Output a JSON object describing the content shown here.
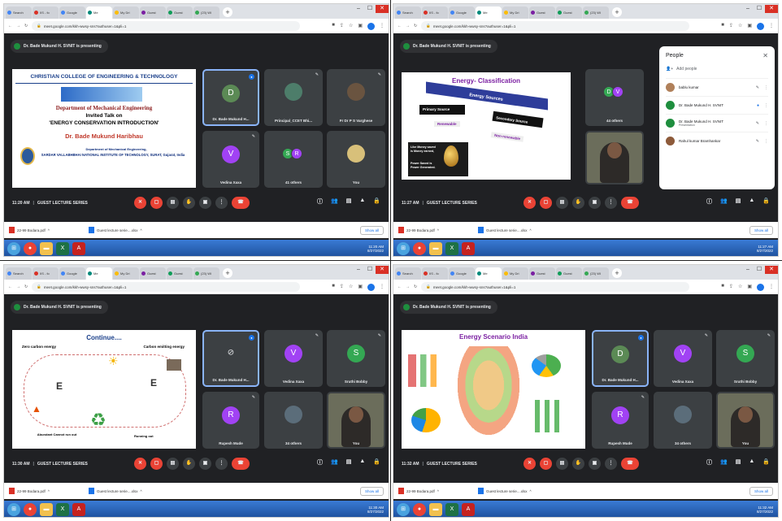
{
  "browser": {
    "tabs": [
      "Search",
      "IIS - fo",
      "Google",
      "Me",
      "My Dri",
      "Guest",
      "Guest",
      "(23) WI"
    ],
    "url": "meet.google.com/kkh-wwsy-sns?authuser=1&pli=1",
    "window_buttons": [
      "–",
      "☐",
      "✕"
    ]
  },
  "presenting_label": "Dr. Bade Mukund H. SVNIT is presenting",
  "meeting_name": "GUEST LECTURE SERIES",
  "downloads": {
    "items": [
      "22-99 Bodara.pdf",
      "Guest lecture serie....xlsx"
    ],
    "show_all": "Show all"
  },
  "panels": [
    {
      "time": "11:20 AM",
      "taskbar_clock": [
        "11:20 AM",
        "8/27/2022"
      ],
      "slide": {
        "college": "CHRISTIAN COLLEGE OF ENGINEERING & TECHNOLOGY",
        "dept": "Department of Mechanical Engineering",
        "talk": "Invited Talk on",
        "topic": "'ENERGY CONSERVATION INTRODUCTION'",
        "speaker": "Dr. Bade Mukund Haribhau",
        "affil_1": "Department of Mechanical Engineering,",
        "affil_2": "SARDAR VALLABHBHAI NATIONAL INSTITUTE OF TECHNOLOGY, SURAT, Gujarat, India"
      },
      "tiles": [
        {
          "name": "Dr. Bade Mukund H...",
          "initial": "D"
        },
        {
          "name": "Principal_CCET Bhi..."
        },
        {
          "name": "Fr Dr P S Varghese"
        },
        {
          "name": "Vedina Xaxa",
          "initial": "V"
        },
        {
          "name": "41 others",
          "initials": [
            "S",
            "R"
          ]
        },
        {
          "name": "You"
        }
      ]
    },
    {
      "time": "11:27 AM",
      "taskbar_clock": [
        "11:27 AM",
        "8/27/2022"
      ],
      "slide": {
        "title": "Energy- Classification",
        "bar": "Energy Sources",
        "primary": "Primary Source",
        "secondary": "Secondary Source",
        "renewable": "Renewable",
        "nonrenewable": "Non-renewable",
        "quote_1": "Like Money saved is Money earned,",
        "quote_2": "Power Saved is Power Generated."
      },
      "tiles": [
        {
          "name": "44 others",
          "initials": [
            "D",
            "V"
          ]
        }
      ],
      "people": {
        "title": "People",
        "add": "Add people",
        "rows": [
          {
            "name": "bablu kumar",
            "role": ""
          },
          {
            "name": "Dr. Bade Mukund H. SVNIT",
            "role": ""
          },
          {
            "name": "Dr. Bade Mukund H. SVNIT",
            "role": "Presentation"
          },
          {
            "name": "Rahul kumar Bramhankar",
            "role": ""
          }
        ]
      }
    },
    {
      "time": "11:30 AM",
      "taskbar_clock": [
        "11:30 AM",
        "8/27/2022"
      ],
      "slide": {
        "title": "Continue....",
        "left": "Zero carbon energy",
        "right": "Carbon emitting energy",
        "bottom_left": "Abundant Cannot run out",
        "bottom_right": "Running out"
      },
      "tiles": [
        {
          "name": "Dr. Bade Mukund H..."
        },
        {
          "name": "Vedina Xaxa",
          "initial": "V"
        },
        {
          "name": "Sruthi Bobby",
          "initial": "S"
        },
        {
          "name": "Rupesh Mude",
          "initial": "R"
        },
        {
          "name": "34 others"
        },
        {
          "name": "You"
        }
      ]
    },
    {
      "time": "11:32 AM",
      "taskbar_clock": [
        "11:32 AM",
        "8/27/2022"
      ],
      "slide": {
        "title": "Energy Scenario India"
      },
      "tiles": [
        {
          "name": "Dr. Bade Mukund H...",
          "initial": "D"
        },
        {
          "name": "Vedina Xaxa",
          "initial": "V"
        },
        {
          "name": "Sruthi Bobby",
          "initial": "S"
        },
        {
          "name": "Rupesh Mude",
          "initial": "R"
        },
        {
          "name": "34 others"
        },
        {
          "name": "You"
        }
      ]
    }
  ],
  "colors": {
    "meet_bg": "#202124",
    "tile_bg": "#3c4043",
    "hangup": "#ea4335",
    "avatar_d": "#1e8e3e",
    "avatar_v": "#a142f4",
    "avatar_s": "#34a853",
    "avatar_r": "#a142f4"
  }
}
